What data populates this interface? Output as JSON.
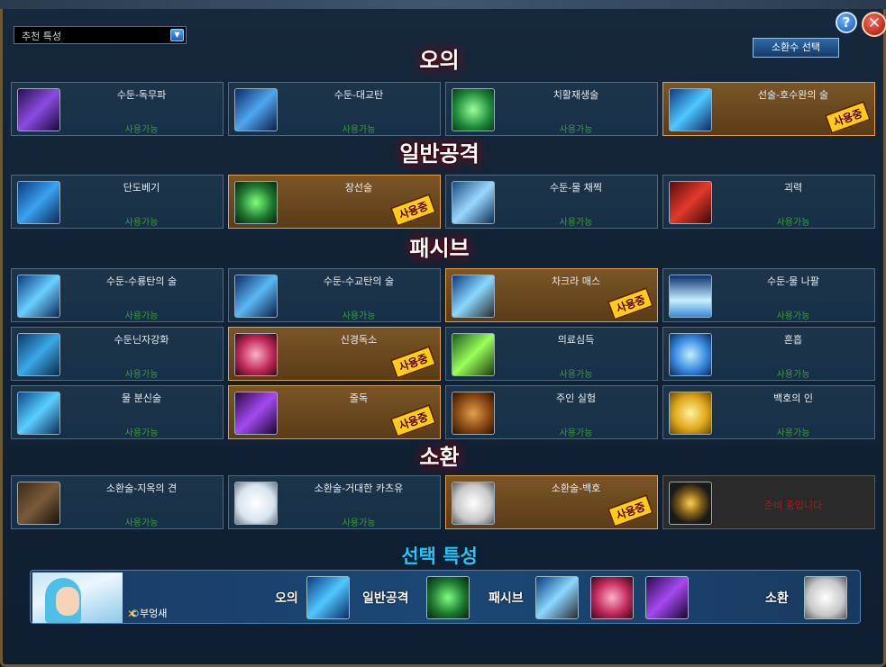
{
  "recommend_dropdown": {
    "selected": "추천 특성"
  },
  "summon_select_label": "소환수 선택",
  "help_label": "?",
  "close_label": "✕",
  "sections": {
    "ougi": "오의",
    "normal": "일반공격",
    "passive": "패시브",
    "summon": "소환"
  },
  "slots": {
    "ougi": [
      {
        "name": "수둔-독무파",
        "status": "사용가능"
      },
      {
        "name": "수둔-대교탄",
        "status": "사용가능"
      },
      {
        "name": "치활재생술",
        "status": "사용가능"
      },
      {
        "name": "선술-호수완의 술",
        "badge": "사용중"
      }
    ],
    "normal": [
      {
        "name": "단도베기",
        "status": "사용가능"
      },
      {
        "name": "장선술",
        "badge": "사용중"
      },
      {
        "name": "수둔-물 채찍",
        "status": "사용가능"
      },
      {
        "name": "괴력",
        "status": "사용가능"
      }
    ],
    "passive": [
      {
        "name": "수둔-수룡탄의 술",
        "status": "사용가능"
      },
      {
        "name": "수둔-수교탄의 술",
        "status": "사용가능"
      },
      {
        "name": "차크라 매스",
        "badge": "사용중"
      },
      {
        "name": "수둔-물 나팔",
        "status": "사용가능"
      },
      {
        "name": "수둔닌자강화",
        "status": "사용가능"
      },
      {
        "name": "신경독소 ",
        "badge": "사용중"
      },
      {
        "name": "의료심득",
        "status": "사용가능"
      },
      {
        "name": "혼흡",
        "status": "사용가능"
      },
      {
        "name": "물 분신술",
        "status": "사용가능"
      },
      {
        "name": "줄독",
        "badge": "사용중"
      },
      {
        "name": "주인 실험",
        "status": "사용가능"
      },
      {
        "name": "백호의 인",
        "status": "사용가능"
      }
    ],
    "summon": [
      {
        "name": "소환술-지옥의 견",
        "status": "사용가능"
      },
      {
        "name": "소환술-거대한 카츠유",
        "status": "사용가능"
      },
      {
        "name": "소환술-백호",
        "badge": "사용중"
      },
      {
        "name": "",
        "status": "준비 중입니다"
      }
    ]
  },
  "bottom": {
    "title": "선택 특성",
    "credit": "©부엉새",
    "labels": {
      "ougi": "오의",
      "normal": "일반공격",
      "passive": "패시브",
      "summon": "소환"
    }
  },
  "colors": {
    "active_bg": "#7b5527",
    "badge": "#ffcc1a",
    "available": "#3e9a3e",
    "locked": "#c81010"
  }
}
